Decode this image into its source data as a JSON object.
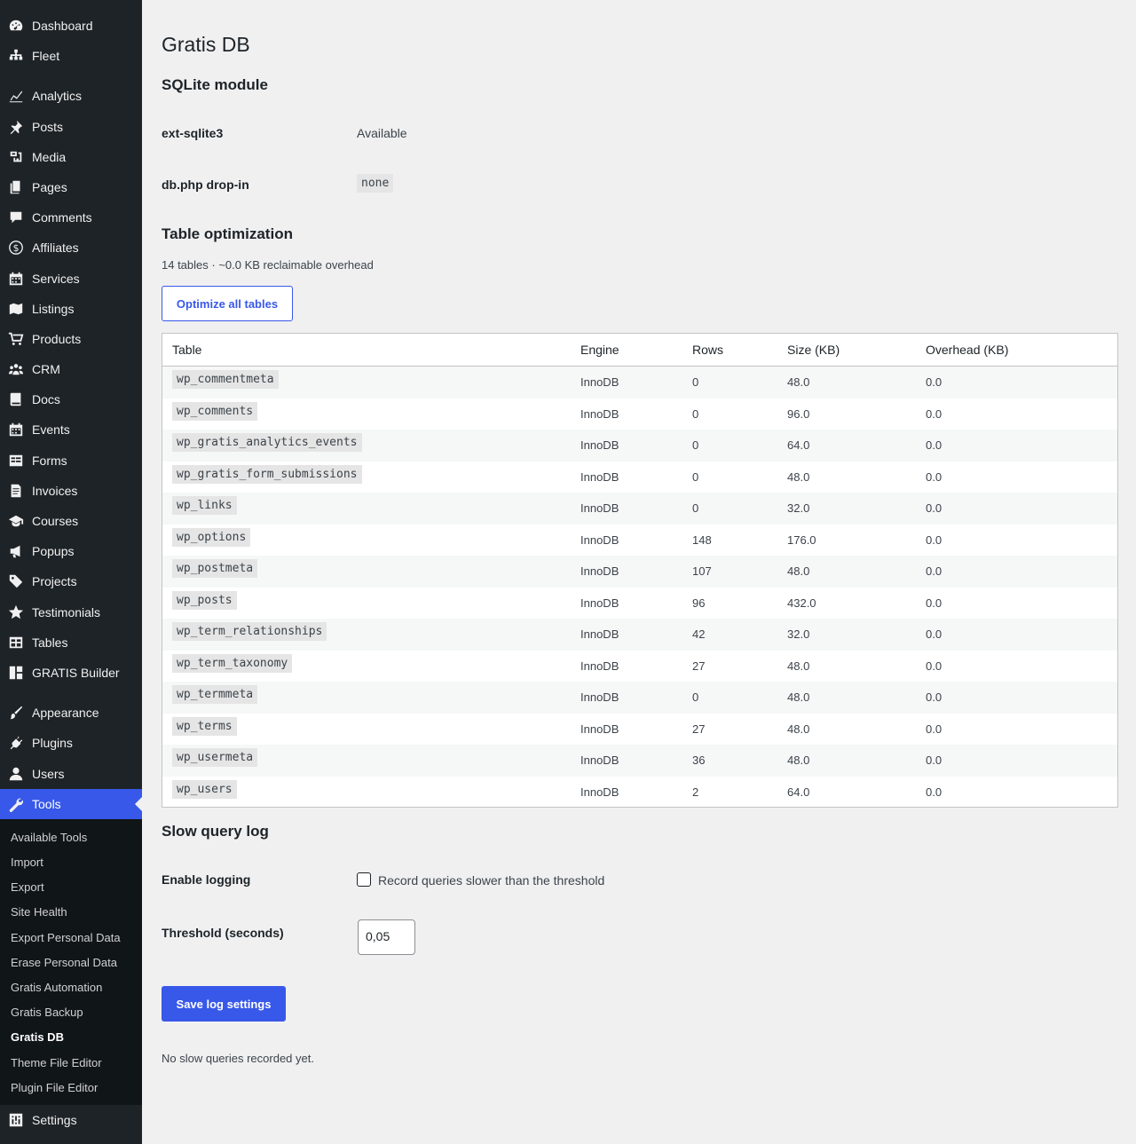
{
  "sidebar": {
    "items": [
      {
        "label": "Dashboard",
        "icon": "dashboard-icon"
      },
      {
        "label": "Fleet",
        "icon": "network-icon"
      },
      {
        "label": "Analytics",
        "icon": "chart-icon"
      },
      {
        "label": "Posts",
        "icon": "pin-icon"
      },
      {
        "label": "Media",
        "icon": "media-icon"
      },
      {
        "label": "Pages",
        "icon": "pages-icon"
      },
      {
        "label": "Comments",
        "icon": "comment-icon"
      },
      {
        "label": "Affiliates",
        "icon": "dollar-icon"
      },
      {
        "label": "Services",
        "icon": "calendar-icon"
      },
      {
        "label": "Listings",
        "icon": "map-icon"
      },
      {
        "label": "Products",
        "icon": "cart-icon"
      },
      {
        "label": "CRM",
        "icon": "groups-icon"
      },
      {
        "label": "Docs",
        "icon": "book-icon"
      },
      {
        "label": "Events",
        "icon": "calendar-icon"
      },
      {
        "label": "Forms",
        "icon": "form-icon"
      },
      {
        "label": "Invoices",
        "icon": "invoice-icon"
      },
      {
        "label": "Courses",
        "icon": "graduation-cap-icon"
      },
      {
        "label": "Popups",
        "icon": "megaphone-icon"
      },
      {
        "label": "Projects",
        "icon": "tag-icon"
      },
      {
        "label": "Testimonials",
        "icon": "star-icon"
      },
      {
        "label": "Tables",
        "icon": "table-icon"
      },
      {
        "label": "GRATIS Builder",
        "icon": "layout-icon"
      },
      {
        "label": "Appearance",
        "icon": "brush-icon"
      },
      {
        "label": "Plugins",
        "icon": "plugin-icon"
      },
      {
        "label": "Users",
        "icon": "user-icon"
      },
      {
        "label": "Tools",
        "icon": "wrench-icon"
      },
      {
        "label": "Settings",
        "icon": "settings-icon"
      }
    ],
    "submenu": [
      "Available Tools",
      "Import",
      "Export",
      "Site Health",
      "Export Personal Data",
      "Erase Personal Data",
      "Gratis Automation",
      "Gratis Backup",
      "Gratis DB",
      "Theme File Editor",
      "Plugin File Editor"
    ],
    "active_item": "Tools",
    "current_submenu": "Gratis DB"
  },
  "page": {
    "title": "Gratis DB",
    "sqlite_heading": "SQLite module",
    "ext_label": "ext-sqlite3",
    "ext_value": "Available",
    "dropin_label": "db.php drop-in",
    "dropin_value": "none",
    "opt_heading": "Table optimization",
    "opt_summary": "14 tables · ~0.0 KB reclaimable overhead",
    "optimize_button": "Optimize all tables",
    "slow_heading": "Slow query log",
    "enable_label": "Enable logging",
    "checkbox_label": "Record queries slower than the threshold",
    "threshold_label": "Threshold (seconds)",
    "threshold_value": "0,05",
    "save_button": "Save log settings",
    "empty_note": "No slow queries recorded yet."
  },
  "table": {
    "headers": [
      "Table",
      "Engine",
      "Rows",
      "Size (KB)",
      "Overhead (KB)"
    ],
    "rows": [
      {
        "name": "wp_commentmeta",
        "engine": "InnoDB",
        "rows": "0",
        "size": "48.0",
        "overhead": "0.0"
      },
      {
        "name": "wp_comments",
        "engine": "InnoDB",
        "rows": "0",
        "size": "96.0",
        "overhead": "0.0"
      },
      {
        "name": "wp_gratis_analytics_events",
        "engine": "InnoDB",
        "rows": "0",
        "size": "64.0",
        "overhead": "0.0"
      },
      {
        "name": "wp_gratis_form_submissions",
        "engine": "InnoDB",
        "rows": "0",
        "size": "48.0",
        "overhead": "0.0"
      },
      {
        "name": "wp_links",
        "engine": "InnoDB",
        "rows": "0",
        "size": "32.0",
        "overhead": "0.0"
      },
      {
        "name": "wp_options",
        "engine": "InnoDB",
        "rows": "148",
        "size": "176.0",
        "overhead": "0.0"
      },
      {
        "name": "wp_postmeta",
        "engine": "InnoDB",
        "rows": "107",
        "size": "48.0",
        "overhead": "0.0"
      },
      {
        "name": "wp_posts",
        "engine": "InnoDB",
        "rows": "96",
        "size": "432.0",
        "overhead": "0.0"
      },
      {
        "name": "wp_term_relationships",
        "engine": "InnoDB",
        "rows": "42",
        "size": "32.0",
        "overhead": "0.0"
      },
      {
        "name": "wp_term_taxonomy",
        "engine": "InnoDB",
        "rows": "27",
        "size": "48.0",
        "overhead": "0.0"
      },
      {
        "name": "wp_termmeta",
        "engine": "InnoDB",
        "rows": "0",
        "size": "48.0",
        "overhead": "0.0"
      },
      {
        "name": "wp_terms",
        "engine": "InnoDB",
        "rows": "27",
        "size": "48.0",
        "overhead": "0.0"
      },
      {
        "name": "wp_usermeta",
        "engine": "InnoDB",
        "rows": "36",
        "size": "48.0",
        "overhead": "0.0"
      },
      {
        "name": "wp_users",
        "engine": "InnoDB",
        "rows": "2",
        "size": "64.0",
        "overhead": "0.0"
      }
    ]
  },
  "colors": {
    "sidebar_bg": "#1d2327",
    "accent": "#3858e9",
    "page_bg": "#f0f0f1"
  }
}
